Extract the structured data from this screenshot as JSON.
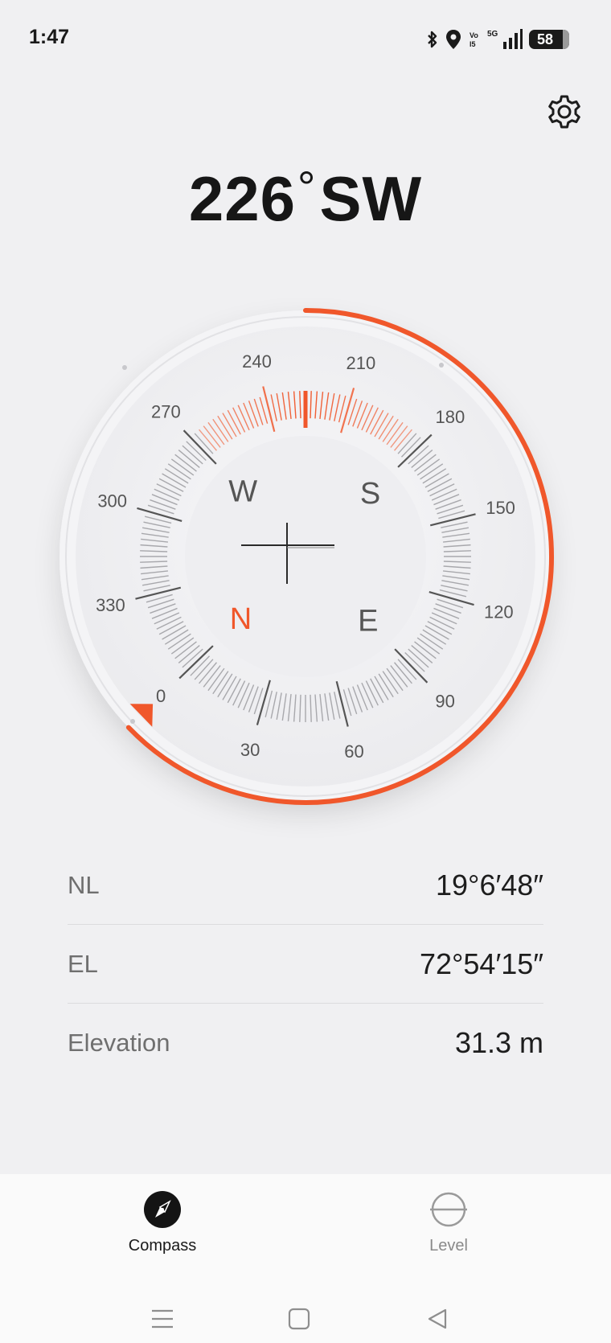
{
  "status_bar": {
    "time": "1:47",
    "battery": "58",
    "network": "5G",
    "icons": [
      "bluetooth-icon",
      "location-icon",
      "volte-icon",
      "signal-icon",
      "battery-icon"
    ]
  },
  "header": {
    "settings_icon": "gear-icon"
  },
  "heading": {
    "degrees": "226",
    "degree_symbol": "°",
    "direction": "SW"
  },
  "compass": {
    "heading_degrees": 226,
    "tick_labels": [
      "0",
      "30",
      "60",
      "90",
      "120",
      "150",
      "180",
      "210",
      "240",
      "270",
      "300",
      "330"
    ],
    "cardinals": {
      "north": "N",
      "east": "E",
      "south": "S",
      "west": "W"
    },
    "accent_color": "#f0572b"
  },
  "info": {
    "rows": [
      {
        "label": "NL",
        "value": "19°6′48″"
      },
      {
        "label": "EL",
        "value": "72°54′15″"
      },
      {
        "label": "Elevation",
        "value": "31.3 m"
      }
    ]
  },
  "bottom_nav": {
    "tabs": [
      {
        "label": "Compass",
        "icon": "compass-icon",
        "active": true
      },
      {
        "label": "Level",
        "icon": "level-icon",
        "active": false
      }
    ]
  },
  "system_nav": {
    "icons": [
      "menu-icon",
      "home-icon",
      "back-icon"
    ]
  }
}
